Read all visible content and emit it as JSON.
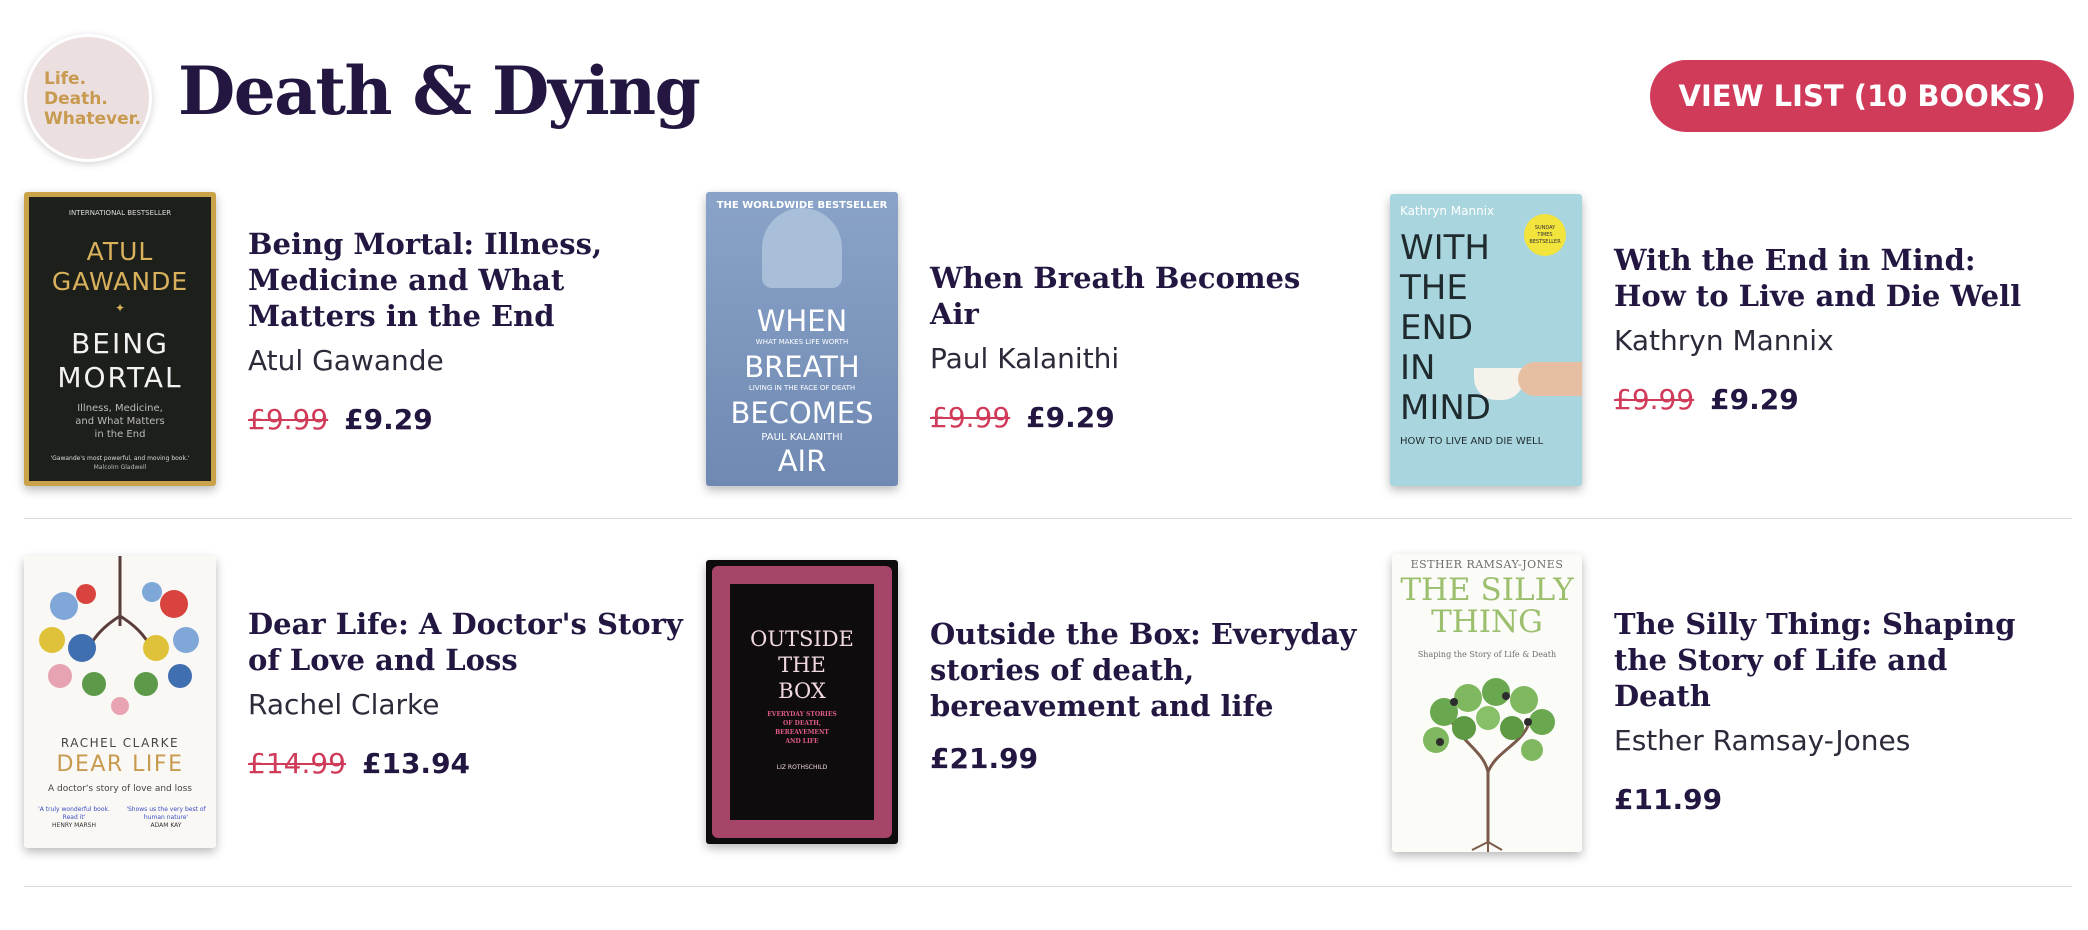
{
  "logo": {
    "lines": [
      "Life.",
      "Death.",
      "Whatever."
    ]
  },
  "page_title": "Death & Dying",
  "view_list_label": "VIEW LIST (10 BOOKS)",
  "colors": {
    "accent": "#d13b5a",
    "title": "#231742"
  },
  "books": [
    {
      "title": "Being Mortal: Illness, Medicine and What Matters in the End",
      "author": "Atul Gawande",
      "old_price": "£9.99",
      "price": "£9.29",
      "cover": {
        "top": "INTERNATIONAL BESTSELLER",
        "author1": "ATUL",
        "author2": "GAWANDE",
        "title1": "BEING",
        "title2": "MORTAL",
        "sub1": "Illness, Medicine,",
        "sub2": "and What Matters",
        "sub3": "in the End",
        "quote": "'Gawande's most powerful, and moving book.'",
        "quote_by": "Malcolm Gladwell"
      }
    },
    {
      "title": "When Breath Becomes Air",
      "author": "Paul Kalanithi",
      "old_price": "£9.99",
      "price": "£9.29",
      "cover": {
        "top": "THE WORLDWIDE BESTSELLER",
        "t1": "WHEN",
        "tag1": "WHAT MAKES LIFE WORTH",
        "t2": "BREATH",
        "tag2": "LIVING IN THE FACE OF DEATH",
        "t3": "BECOMES",
        "author": "PAUL KALANITHI",
        "t4": "AIR"
      }
    },
    {
      "title": "With the End in Mind: How to Live and Die Well",
      "author": "Kathryn Mannix",
      "old_price": "£9.99",
      "price": "£9.29",
      "cover": {
        "author": "Kathryn Mannix",
        "badge1": "SUNDAY",
        "badge2": "TIMES",
        "badge3": "BESTSELLER",
        "t1": "WITH",
        "t2": "THE",
        "t3": "END",
        "t4": "IN",
        "t5": "MIND",
        "sub": "HOW TO LIVE AND DIE WELL"
      }
    },
    {
      "title": "Dear Life: A Doctor's Story of Love and Loss",
      "author": "Rachel Clarke",
      "old_price": "£14.99",
      "price": "£13.94",
      "cover": {
        "author": "RACHEL CLARKE",
        "t1": "DEAR LIFE",
        "sub": "A doctor's story of love and loss",
        "q1": "'A truly wonderful book. Read it'",
        "q1by": "HENRY MARSH",
        "q2": "'Shows us the very best of human nature'",
        "q2by": "ADAM KAY"
      }
    },
    {
      "title": "Outside the Box: Everyday stories of death, bereavement and life",
      "author": "",
      "old_price": "",
      "price": "£21.99",
      "cover": {
        "t1": "OUTSIDE",
        "t2": "THE",
        "t3": "BOX",
        "sub1": "EVERYDAY STORIES",
        "sub2": "OF DEATH,",
        "sub3": "BEREAVEMENT",
        "sub4": "AND LIFE",
        "ed": "LIZ ROTHSCHILD"
      }
    },
    {
      "title": "The Silly Thing: Shaping the Story of Life and Death",
      "author": "Esther Ramsay-Jones",
      "old_price": "",
      "price": "£11.99",
      "cover": {
        "author": "ESTHER RAMSAY-JONES",
        "t1": "THE SILLY",
        "t2": "THING",
        "sub": "Shaping the Story of Life & Death"
      }
    }
  ]
}
